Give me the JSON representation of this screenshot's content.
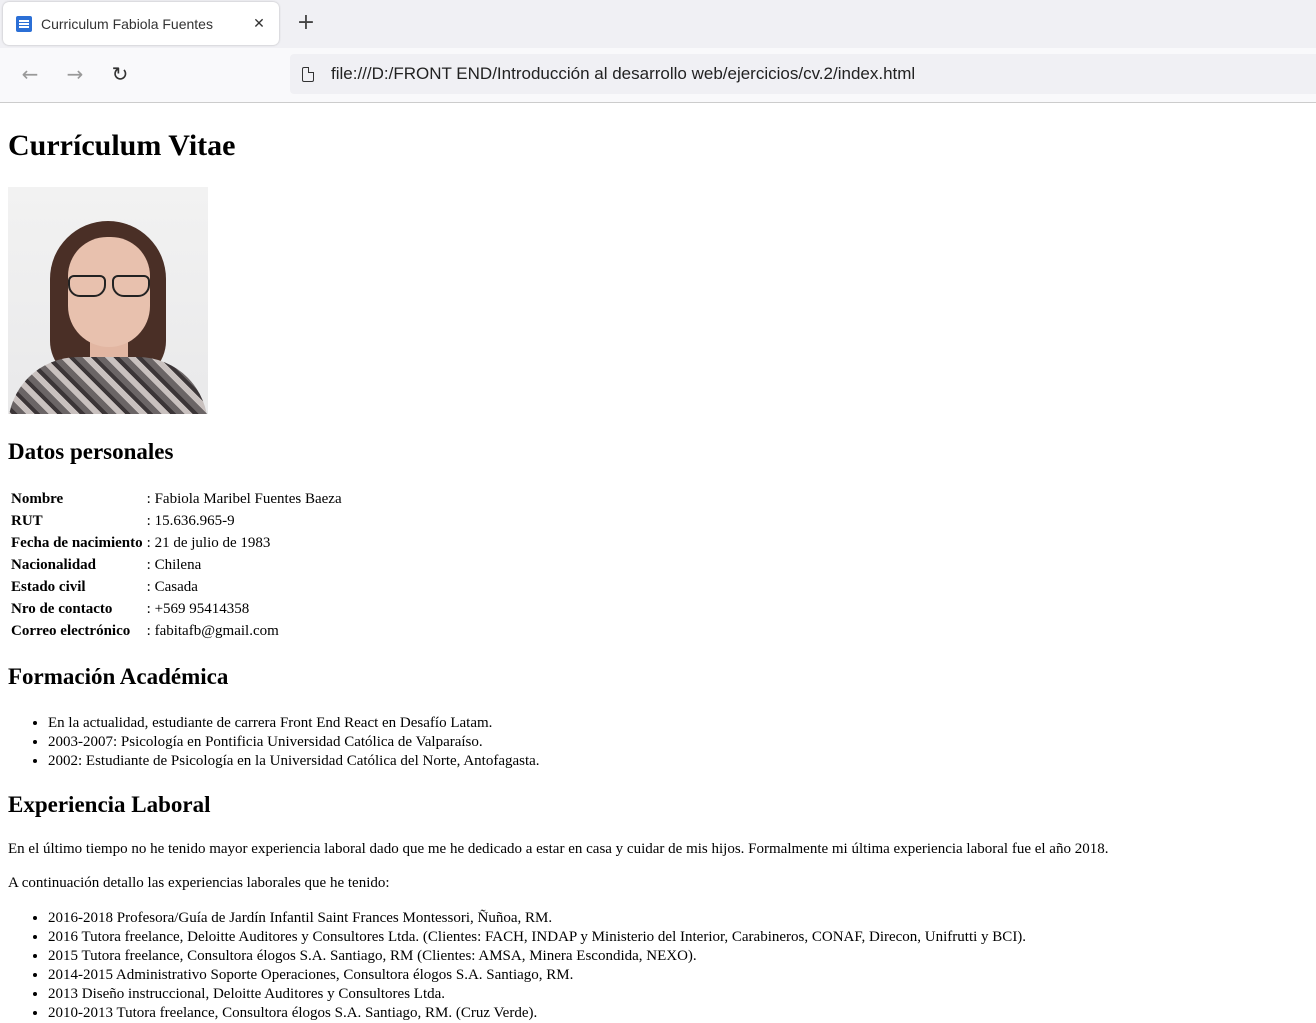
{
  "browser": {
    "tab_title": "Curriculum Fabiola Fuentes",
    "tab_close": "✕",
    "new_tab": "+",
    "back": "←",
    "forward": "→",
    "reload": "↻",
    "url": "file:///D:/FRONT END/Introducción al desarrollo web/ejercicios/cv.2/index.html"
  },
  "page": {
    "title": "Currículum Vitae",
    "personal": {
      "heading": "Datos personales",
      "rows": [
        {
          "key": "Nombre",
          "value": ": Fabiola Maribel Fuentes Baeza"
        },
        {
          "key": "RUT",
          "value": ": 15.636.965-9"
        },
        {
          "key": "Fecha de nacimiento",
          "value": ": 21 de julio de 1983"
        },
        {
          "key": "Nacionalidad",
          "value": ": Chilena"
        },
        {
          "key": "Estado civil",
          "value": ": Casada"
        },
        {
          "key": "Nro de contacto",
          "value": ": +569 95414358"
        },
        {
          "key": "Correo electrónico",
          "value": ": fabitafb@gmail.com"
        }
      ]
    },
    "education": {
      "heading": "Formación Académica",
      "items": [
        "En la actualidad, estudiante de carrera Front End React en Desafío Latam.",
        "2003-2007: Psicología en Pontificia Universidad Católica de Valparaíso.",
        "2002: Estudiante de Psicología en la Universidad Católica del Norte, Antofagasta."
      ]
    },
    "experience": {
      "heading": "Experiencia Laboral",
      "paragraph1": "En el último tiempo no he tenido mayor experiencia laboral dado que me he dedicado a estar en casa y cuidar de mis hijos. Formalmente mi última experiencia laboral fue el año 2018.",
      "paragraph2": "A continuación detallo las experiencias laborales que he tenido:",
      "items": [
        "2016-2018 Profesora/Guía de Jardín Infantil Saint Frances Montessori, Ñuñoa, RM.",
        "2016 Tutora freelance, Deloitte Auditores y Consultores Ltda. (Clientes: FACH, INDAP y Ministerio del Interior, Carabineros, CONAF, Direcon, Unifrutti y BCI).",
        "2015 Tutora freelance, Consultora élogos S.A. Santiago, RM (Clientes: AMSA, Minera Escondida, NEXO).",
        "2014-2015 Administrativo Soporte Operaciones, Consultora élogos S.A. Santiago, RM.",
        "2013 Diseño instruccional, Deloitte Auditores y Consultores Ltda.",
        "2010-2013 Tutora freelance, Consultora élogos S.A. Santiago, RM. (Cruz Verde)."
      ]
    }
  }
}
